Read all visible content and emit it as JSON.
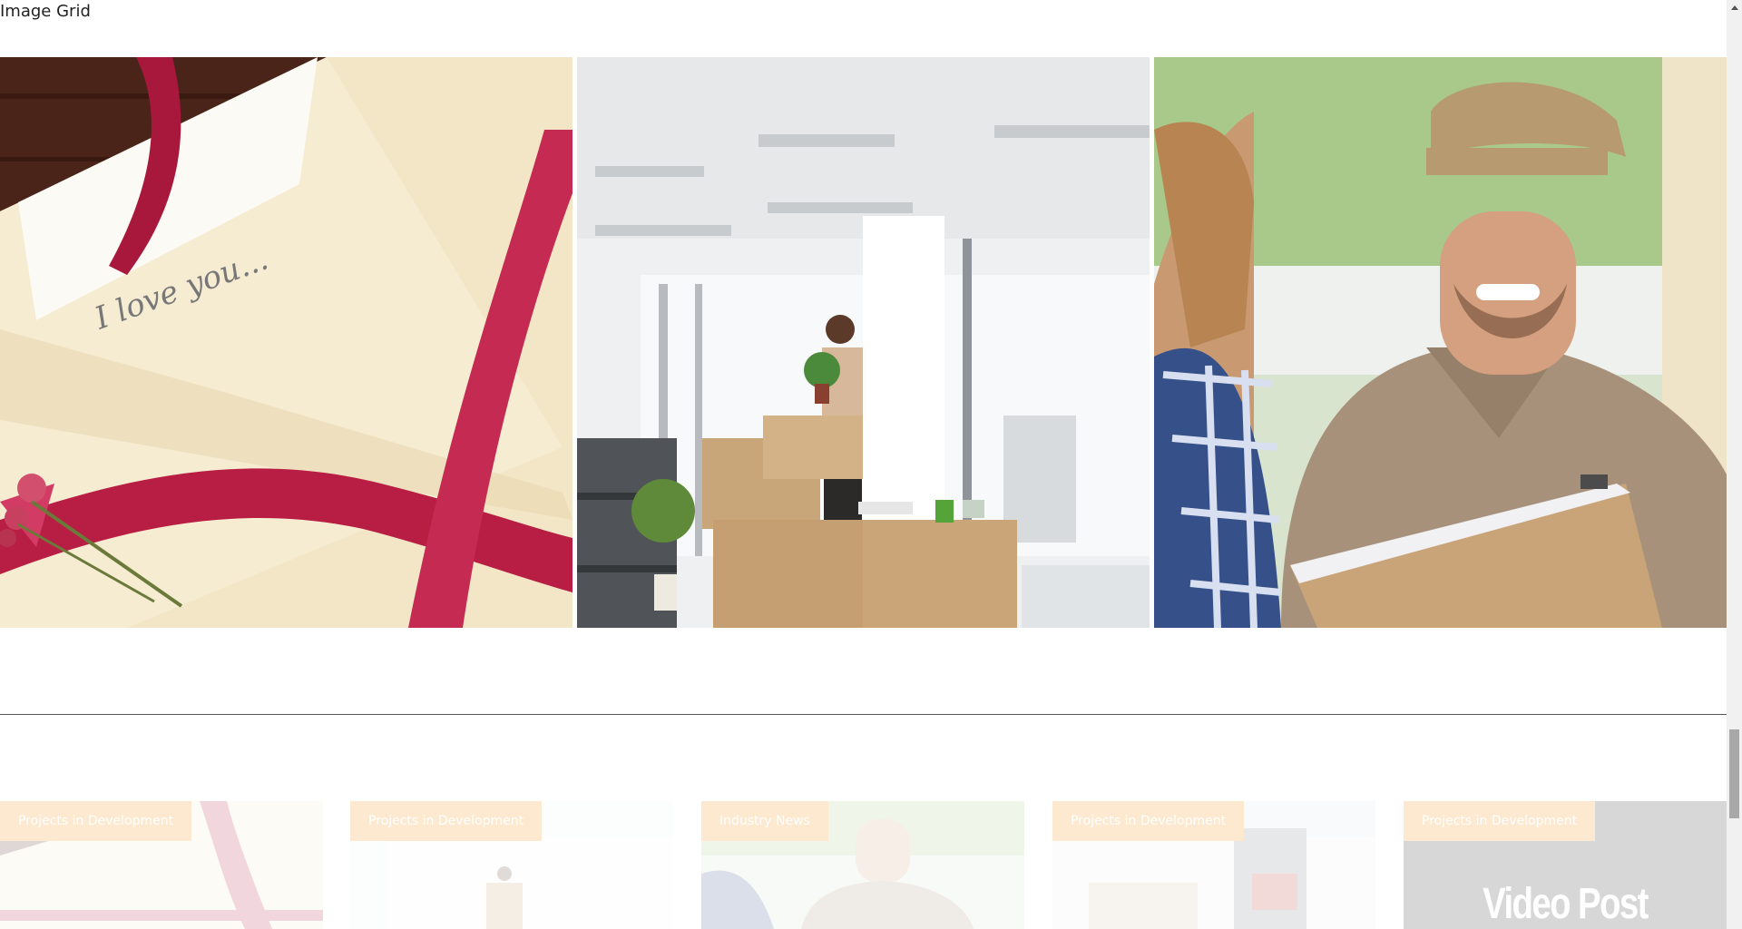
{
  "section": {
    "title": "Image Grid"
  },
  "image_grid": [
    {
      "alt": "envelope-with-red-ribbon-and-roses",
      "icon": "photo-envelope"
    },
    {
      "alt": "woman-unpacking-boxes-in-office",
      "icon": "photo-office-moving"
    },
    {
      "alt": "delivery-man-with-package",
      "icon": "photo-delivery-man"
    }
  ],
  "posts": [
    {
      "category": "Projects in Development"
    },
    {
      "category": "Projects in Development"
    },
    {
      "category": "Industry News"
    },
    {
      "category": "Projects in Development"
    },
    {
      "category": "Projects in Development",
      "video_title": "Video Post"
    }
  ],
  "colors": {
    "category_badge": "#fde9cf",
    "divider": "#555555",
    "scroll_thumb": "#a8a8a8"
  }
}
